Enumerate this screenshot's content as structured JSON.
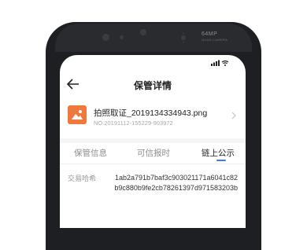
{
  "device": {
    "camera_label": "64MP",
    "camera_sublabel": "QUAD CAMERA"
  },
  "header": {
    "title": "保管详情"
  },
  "file": {
    "name": "拍照取证_2019134334943.png",
    "number": "NO.20191112-155229-903972"
  },
  "tabs": [
    {
      "label": "保管信息",
      "active": false
    },
    {
      "label": "可信报时",
      "active": false
    },
    {
      "label": "链上公示",
      "active": true
    }
  ],
  "hash": {
    "label": "交易哈希",
    "value": "1ab2a791b7baf3c903021171a6041c82b9c880b9fe2cb78261397d971583203b"
  },
  "colors": {
    "accent": "#3a7bf5",
    "file_icon": "#f0783c",
    "phone_body": "#1e1f22"
  }
}
